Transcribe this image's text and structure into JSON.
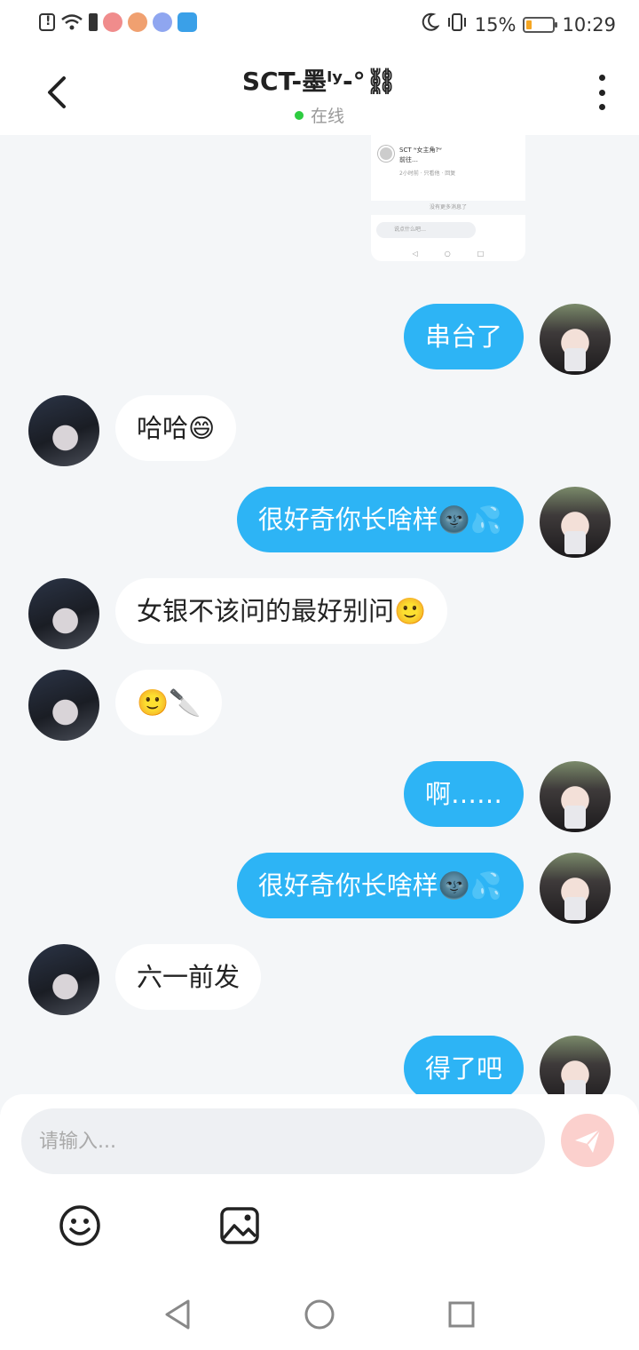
{
  "status_bar": {
    "battery_pct": "15%",
    "time": "10:29",
    "icons": [
      "alert-icon",
      "wifi-icon",
      "battery-saver-icon",
      "app-icon",
      "app-icon",
      "music-icon",
      "browser-icon",
      "moon-icon",
      "vibrate-icon",
      "battery-icon"
    ]
  },
  "header": {
    "title": "SCT-墨ˡʸ-°⛓",
    "status": "在线"
  },
  "shared_screenshot": {
    "line1": "SCT ʷ女主角?ʷ",
    "line2": "前往…",
    "line3": "2小时前 · 只看他 · 回复",
    "separator": "没有更多消息了",
    "input_placeholder": "说点什么吧…"
  },
  "messages": [
    {
      "side": "me",
      "text": "串台了"
    },
    {
      "side": "them",
      "text": "哈哈😄"
    },
    {
      "side": "me",
      "text": "很好奇你长啥样🌚💦"
    },
    {
      "side": "them",
      "text": "女银不该问的最好别问🙂"
    },
    {
      "side": "them",
      "text": "🙂🔪"
    },
    {
      "side": "me",
      "text": "啊……"
    },
    {
      "side": "me",
      "text": "很好奇你长啥样🌚💦"
    },
    {
      "side": "them",
      "text": "六一前发"
    },
    {
      "side": "me",
      "text": "得了吧"
    }
  ],
  "composer": {
    "placeholder": "请输入..."
  },
  "colors": {
    "my_bubble": "#2db4f5",
    "their_bubble": "#ffffff",
    "send_button": "#fbd0cd",
    "online_dot": "#2ecc40"
  }
}
